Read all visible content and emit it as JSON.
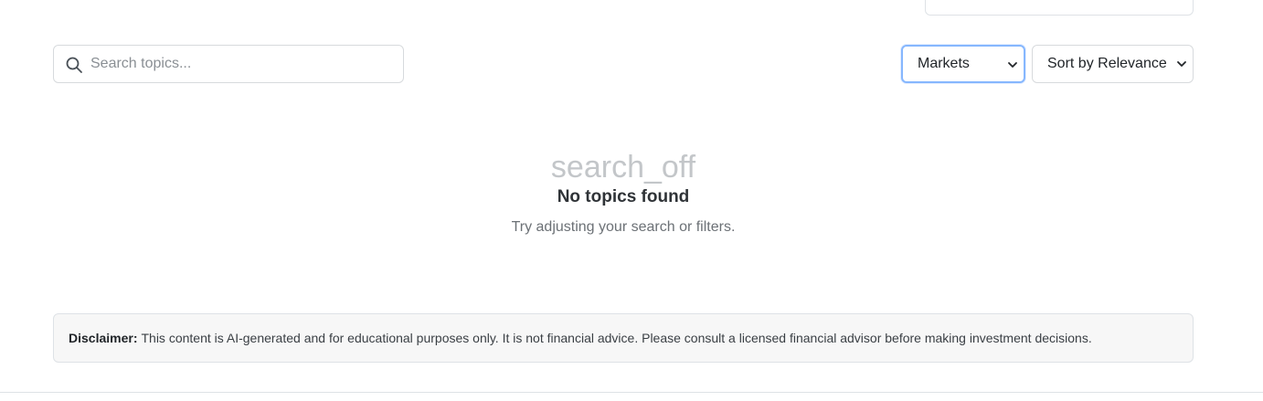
{
  "search": {
    "placeholder": "Search topics...",
    "value": "",
    "icon": "search-icon"
  },
  "filters": {
    "category_selected": "Markets",
    "sort_selected": "Sort by Relevance"
  },
  "empty_state": {
    "icon_text": "search_off",
    "title": "No topics found",
    "subtitle": "Try adjusting your search or filters."
  },
  "disclaimer": {
    "label": "Disclaimer:",
    "text": "This content is AI-generated and for educational purposes only. It is not financial advice. Please consult a licensed financial advisor before making investment decisions."
  },
  "colors": {
    "focus_border": "#86b7fe",
    "muted_icon": "#c3c6c9",
    "disclaimer_bg": "#f7f7f7"
  }
}
